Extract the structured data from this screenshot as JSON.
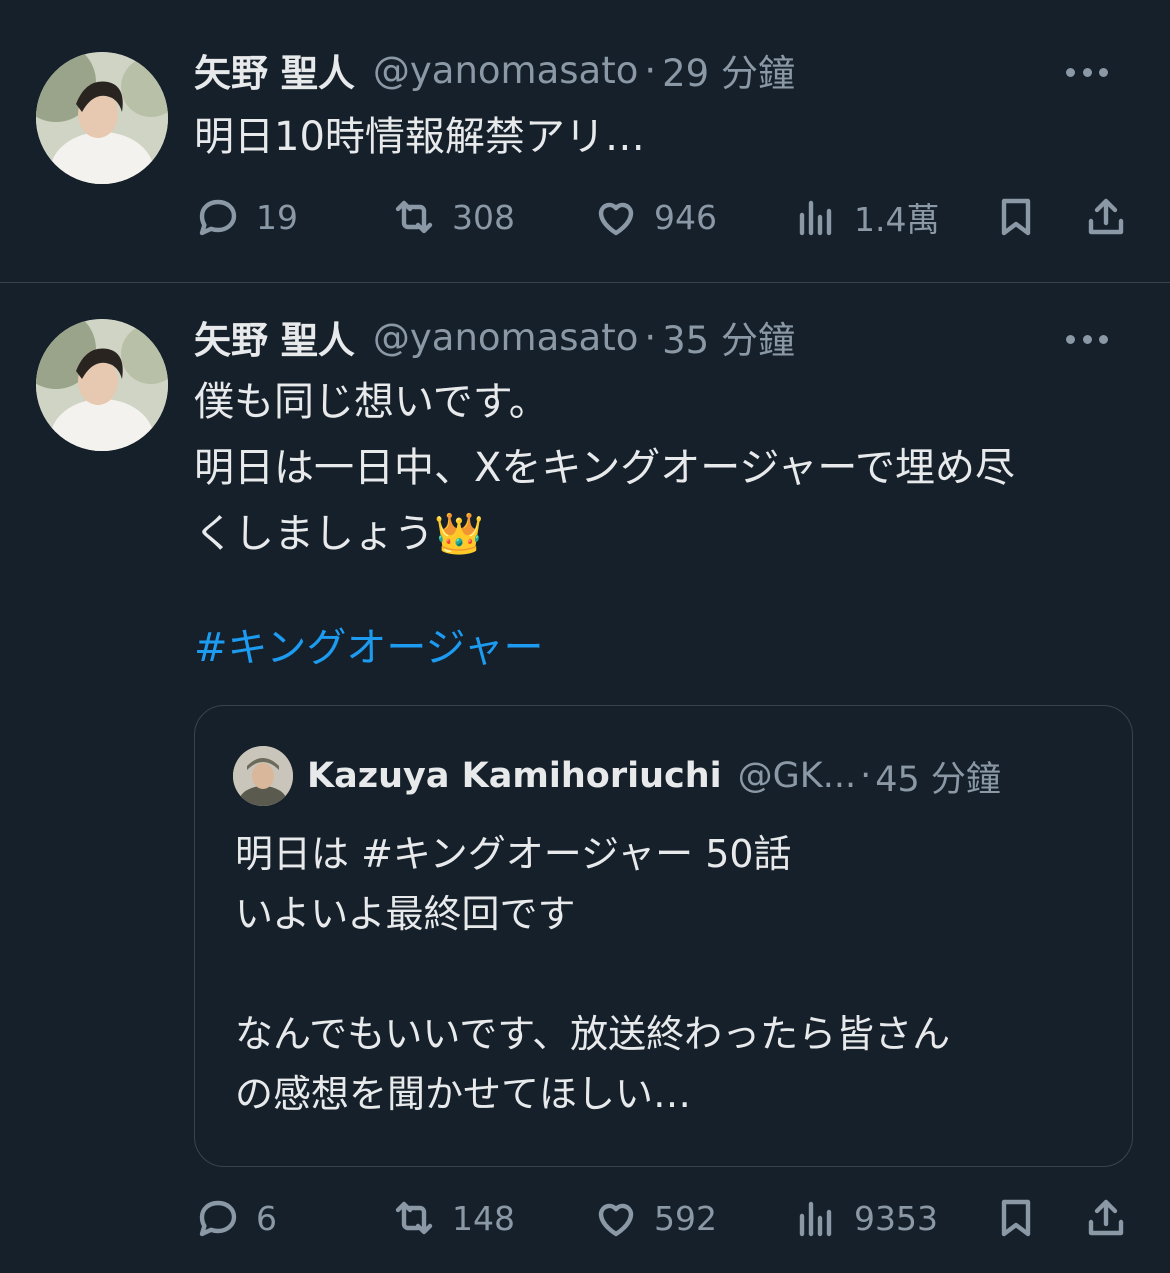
{
  "colors": {
    "background": "#15202b",
    "text": "#e7e9ea",
    "muted": "#8b98a5",
    "link": "#1d9bf0",
    "border": "#38444d"
  },
  "tweets": [
    {
      "author_name": "矢野 聖人",
      "handle": "@yanomasato",
      "separator": "·",
      "time": "29 分鐘",
      "text": "明日10時情報解禁アリ…",
      "stats": {
        "replies": "19",
        "retweets": "308",
        "likes": "946",
        "views": "1.4萬"
      }
    },
    {
      "author_name": "矢野 聖人",
      "handle": "@yanomasato",
      "separator": "·",
      "time": "35 分鐘",
      "text_lines": [
        "僕も同じ想いです。",
        "明日は一日中、Xをキングオージャーで埋め尽",
        "くしましょう👑"
      ],
      "hashtag": "#キングオージャー",
      "quote": {
        "author_name": "Kazuya Kamihoriuchi",
        "handle": "@GK...",
        "separator": "·",
        "time": "45 分鐘",
        "text_lines": [
          "明日は #キングオージャー 50話",
          "いよいよ最終回です",
          "",
          "なんでもいいです、放送終わったら皆さん",
          "の感想を聞かせてほしい…"
        ]
      },
      "stats": {
        "replies": "6",
        "retweets": "148",
        "likes": "592",
        "views": "9353"
      }
    }
  ],
  "icons": [
    "reply-icon",
    "retweet-icon",
    "like-icon",
    "views-icon",
    "bookmark-icon",
    "share-icon",
    "more-icon"
  ]
}
